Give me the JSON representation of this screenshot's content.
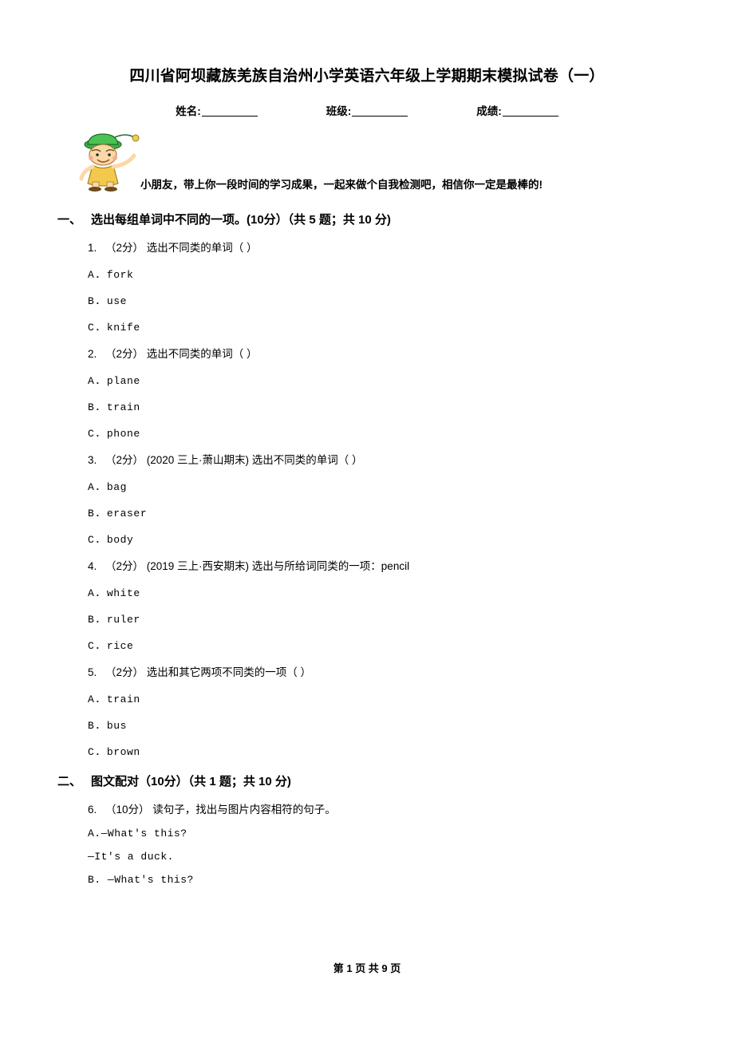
{
  "document": {
    "title": "四川省阿坝藏族羌族自治州小学英语六年级上学期期末模拟试卷（一）",
    "info_fields": [
      {
        "label": "姓名:"
      },
      {
        "label": "班级:"
      },
      {
        "label": "成绩:"
      }
    ],
    "greeting": "小朋友，带上你一段时间的学习成果，一起来做个自我检测吧，相信你一定是最棒的!",
    "footer": "第 1 页 共 9 页",
    "sections": [
      {
        "index": "一、",
        "heading": "选出每组单词中不同的一项。(10分）（共 5 题；共 10 分)",
        "questions": [
          {
            "number": "1.",
            "score": "（2分）",
            "text": "选出不同类的单词（      ）",
            "options": [
              {
                "label": "A．",
                "text": "fork"
              },
              {
                "label": "B．",
                "text": "use"
              },
              {
                "label": "C．",
                "text": "knife"
              }
            ]
          },
          {
            "number": "2.",
            "score": "（2分）",
            "text": "选出不同类的单词（      ）",
            "options": [
              {
                "label": "A．",
                "text": "plane"
              },
              {
                "label": "B．",
                "text": "train"
              },
              {
                "label": "C．",
                "text": "phone"
              }
            ]
          },
          {
            "number": "3.",
            "score": "（2分）",
            "text": "(2020 三上·萧山期末) 选出不同类的单词（      ）",
            "options": [
              {
                "label": "A．",
                "text": "bag"
              },
              {
                "label": "B．",
                "text": "eraser"
              },
              {
                "label": "C．",
                "text": "body"
              }
            ]
          },
          {
            "number": "4.",
            "score": "（2分）",
            "text": "(2019 三上·西安期末) 选出与所给词同类的一项：pencil",
            "options": [
              {
                "label": "A．",
                "text": "white"
              },
              {
                "label": "B．",
                "text": "ruler"
              },
              {
                "label": "C．",
                "text": "rice"
              }
            ]
          },
          {
            "number": "5.",
            "score": "（2分）",
            "text": "选出和其它两项不同类的一项（      ）",
            "options": [
              {
                "label": "A．",
                "text": "train"
              },
              {
                "label": "B．",
                "text": "bus"
              },
              {
                "label": "C．",
                "text": "brown"
              }
            ]
          }
        ]
      },
      {
        "index": "二、",
        "heading": "图文配对（10分）（共 1 题；共 10 分)",
        "questions": [
          {
            "number": "6.",
            "score": "（10分）",
            "text": "读句子，找出与图片内容相符的句子。",
            "lines": [
              "A.—What's this?",
              "—It's a duck.",
              "B.  —What's this?"
            ]
          }
        ]
      }
    ]
  }
}
